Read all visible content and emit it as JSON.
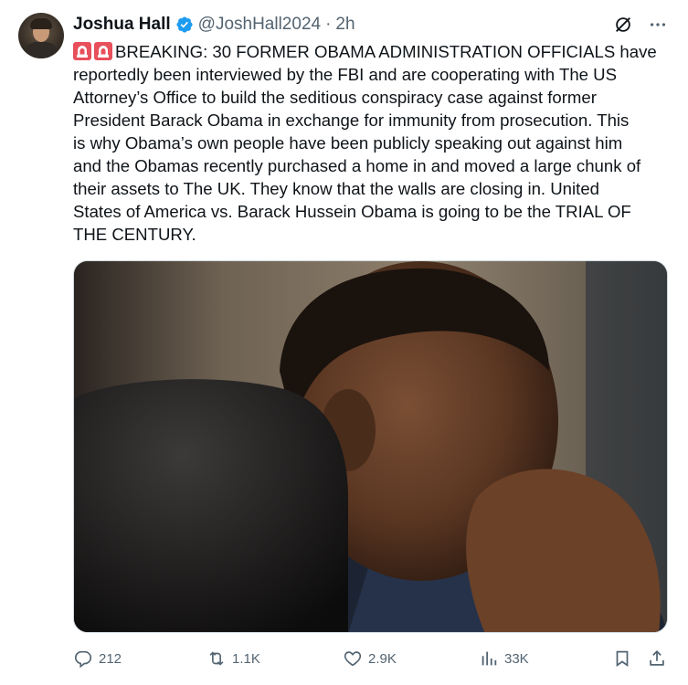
{
  "tweet": {
    "author_name": "Joshua Hall",
    "handle": "@JoshHall2024",
    "separator": "·",
    "time": "2h",
    "body": "BREAKING: 30 FORMER OBAMA ADMINISTRATION OFFICIALS have\nreportedly been interviewed by the FBI and are cooperating with The US\nAttorney’s Office to build the seditious conspiracy case against former\nPresident Barack Obama in exchange for immunity from prosecution. This\nis why Obama’s own people have been publicly speaking out against him\nand the Obamas recently purchased a home in and moved a large chunk of\ntheir assets to The UK. They know that the walls are closing in. United\nStates of America vs. Barack Hussein Obama is going to be the TRIAL OF\nTHE CENTURY.",
    "verified_color": "#1d9bf0"
  },
  "actions": {
    "replies": "212",
    "reposts": "1.1K",
    "likes": "2.9K",
    "views": "33K"
  },
  "icons": {
    "verified": "verified-badge-icon",
    "grok": "grok-icon",
    "more": "more-icon",
    "siren": "police-siren-emoji",
    "reply": "reply-icon",
    "repost": "repost-icon",
    "like": "heart-icon",
    "views": "views-icon",
    "bookmark": "bookmark-icon",
    "share": "share-icon"
  },
  "colors": {
    "text": "#0f1419",
    "secondary": "#536471",
    "accent": "#1d9bf0"
  }
}
